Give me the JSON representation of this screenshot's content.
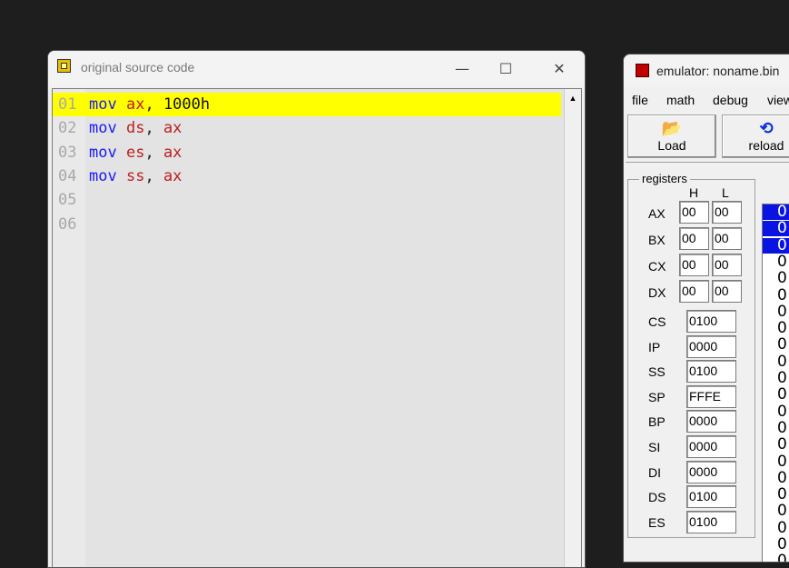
{
  "source_window": {
    "title": "original source code",
    "controls": {
      "minimize": "—",
      "maximize": "☐",
      "close": "✕"
    },
    "lines": [
      {
        "num": "01",
        "tokens": [
          [
            "kw",
            "mov"
          ],
          [
            "sp",
            " "
          ],
          [
            "reg",
            "ax"
          ],
          [
            "punc",
            ", "
          ],
          [
            "num",
            "1000h"
          ]
        ],
        "highlight": true
      },
      {
        "num": "02",
        "tokens": [
          [
            "kw",
            "mov"
          ],
          [
            "sp",
            " "
          ],
          [
            "reg",
            "ds"
          ],
          [
            "punc",
            ", "
          ],
          [
            "reg",
            "ax"
          ]
        ],
        "highlight": false
      },
      {
        "num": "03",
        "tokens": [
          [
            "kw",
            "mov"
          ],
          [
            "sp",
            " "
          ],
          [
            "reg",
            "es"
          ],
          [
            "punc",
            ", "
          ],
          [
            "reg",
            "ax"
          ]
        ],
        "highlight": false
      },
      {
        "num": "04",
        "tokens": [
          [
            "kw",
            "mov"
          ],
          [
            "sp",
            " "
          ],
          [
            "reg",
            "ss"
          ],
          [
            "punc",
            ", "
          ],
          [
            "reg",
            "ax"
          ]
        ],
        "highlight": false
      },
      {
        "num": "05",
        "tokens": [],
        "highlight": false
      },
      {
        "num": "06",
        "tokens": [],
        "highlight": false
      }
    ],
    "scroll_up": "▲"
  },
  "emulator_window": {
    "title": "emulator: noname.bin",
    "menu": [
      "file",
      "math",
      "debug",
      "view"
    ],
    "toolbar": [
      {
        "label": "Load",
        "icon": "open-folder-icon",
        "glyph": "📂"
      },
      {
        "label": "reload",
        "icon": "reload-icon",
        "glyph": "⟲"
      }
    ],
    "registers": {
      "legend": "registers",
      "header_h": "H",
      "header_l": "L",
      "split": [
        {
          "name": "AX",
          "h": "00",
          "l": "00"
        },
        {
          "name": "BX",
          "h": "00",
          "l": "00"
        },
        {
          "name": "CX",
          "h": "00",
          "l": "00"
        },
        {
          "name": "DX",
          "h": "00",
          "l": "00"
        }
      ],
      "full": [
        {
          "name": "CS",
          "value": "0100"
        },
        {
          "name": "IP",
          "value": "0000"
        },
        {
          "name": "SS",
          "value": "0100"
        },
        {
          "name": "SP",
          "value": "FFFE"
        },
        {
          "name": "BP",
          "value": "0000"
        },
        {
          "name": "SI",
          "value": "0000"
        },
        {
          "name": "DI",
          "value": "0000"
        },
        {
          "name": "DS",
          "value": "0100"
        },
        {
          "name": "ES",
          "value": "0100"
        }
      ]
    },
    "memory_rows": [
      "0",
      "0",
      "0",
      "0",
      "0",
      "0",
      "0",
      "0",
      "0",
      "0",
      "0",
      "0",
      "0",
      "0",
      "0",
      "0",
      "0",
      "0",
      "0",
      "0",
      "0",
      "0"
    ],
    "memory_selected_count": 3,
    "colors": {
      "highlight_line": "#ffff00",
      "selection": "#0a14e0",
      "keyword": "#1a1aff",
      "register": "#c02020"
    }
  }
}
